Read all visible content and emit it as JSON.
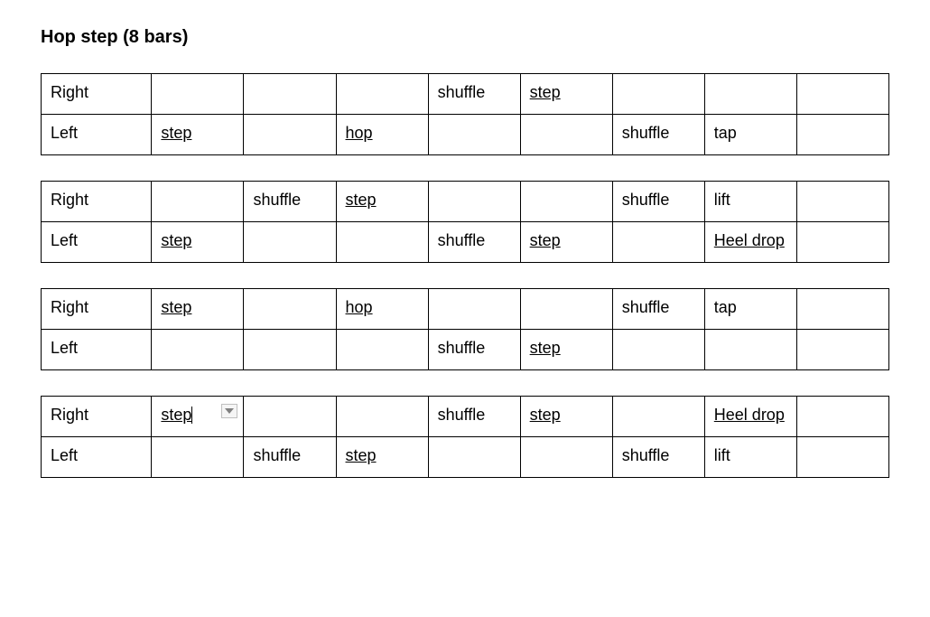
{
  "title": "Hop step (8 bars)",
  "row_labels": {
    "right": "Right",
    "left": "Left"
  },
  "tables": [
    {
      "rows": [
        {
          "label_key": "right",
          "cells": [
            {
              "text": "",
              "underline": false
            },
            {
              "text": "",
              "underline": false
            },
            {
              "text": "",
              "underline": false
            },
            {
              "text": "shuffle",
              "underline": false
            },
            {
              "text": "step",
              "underline": true
            },
            {
              "text": "",
              "underline": false
            },
            {
              "text": "",
              "underline": false
            },
            {
              "text": "",
              "underline": false
            }
          ]
        },
        {
          "label_key": "left",
          "cells": [
            {
              "text": "step",
              "underline": true
            },
            {
              "text": "",
              "underline": false
            },
            {
              "text": "hop",
              "underline": true
            },
            {
              "text": "",
              "underline": false
            },
            {
              "text": "",
              "underline": false
            },
            {
              "text": "shuffle",
              "underline": false
            },
            {
              "text": "tap",
              "underline": false
            },
            {
              "text": "",
              "underline": false
            }
          ]
        }
      ]
    },
    {
      "rows": [
        {
          "label_key": "right",
          "cells": [
            {
              "text": "",
              "underline": false
            },
            {
              "text": "shuffle",
              "underline": false
            },
            {
              "text": "step",
              "underline": true
            },
            {
              "text": "",
              "underline": false
            },
            {
              "text": "",
              "underline": false
            },
            {
              "text": "shuffle",
              "underline": false
            },
            {
              "text": "lift",
              "underline": false
            },
            {
              "text": "",
              "underline": false
            }
          ]
        },
        {
          "label_key": "left",
          "cells": [
            {
              "text": "step",
              "underline": true
            },
            {
              "text": "",
              "underline": false
            },
            {
              "text": "",
              "underline": false
            },
            {
              "text": "shuffle",
              "underline": false
            },
            {
              "text": "step",
              "underline": true
            },
            {
              "text": "",
              "underline": false
            },
            {
              "text": "Heel drop",
              "underline": true
            },
            {
              "text": "",
              "underline": false
            }
          ]
        }
      ]
    },
    {
      "rows": [
        {
          "label_key": "right",
          "cells": [
            {
              "text": "step",
              "underline": true
            },
            {
              "text": "",
              "underline": false
            },
            {
              "text": "hop",
              "underline": true
            },
            {
              "text": "",
              "underline": false
            },
            {
              "text": "",
              "underline": false
            },
            {
              "text": "shuffle",
              "underline": false
            },
            {
              "text": "tap",
              "underline": false
            },
            {
              "text": "",
              "underline": false
            }
          ]
        },
        {
          "label_key": "left",
          "cells": [
            {
              "text": "",
              "underline": false
            },
            {
              "text": "",
              "underline": false
            },
            {
              "text": "",
              "underline": false
            },
            {
              "text": "shuffle",
              "underline": false
            },
            {
              "text": "step",
              "underline": true
            },
            {
              "text": "",
              "underline": false
            },
            {
              "text": "",
              "underline": false
            },
            {
              "text": "",
              "underline": false
            }
          ]
        }
      ]
    },
    {
      "rows": [
        {
          "label_key": "right",
          "cells": [
            {
              "text": "step",
              "underline": true,
              "cursor": true,
              "dropdown": true
            },
            {
              "text": "",
              "underline": false
            },
            {
              "text": "",
              "underline": false
            },
            {
              "text": "shuffle",
              "underline": false
            },
            {
              "text": "step",
              "underline": true
            },
            {
              "text": "",
              "underline": false
            },
            {
              "text": "Heel drop",
              "underline": true
            },
            {
              "text": "",
              "underline": false
            }
          ]
        },
        {
          "label_key": "left",
          "cells": [
            {
              "text": "",
              "underline": false
            },
            {
              "text": "shuffle",
              "underline": false
            },
            {
              "text": "step",
              "underline": true
            },
            {
              "text": "",
              "underline": false
            },
            {
              "text": "",
              "underline": false
            },
            {
              "text": "shuffle",
              "underline": false
            },
            {
              "text": "lift",
              "underline": false
            },
            {
              "text": "",
              "underline": false
            }
          ]
        }
      ]
    }
  ]
}
